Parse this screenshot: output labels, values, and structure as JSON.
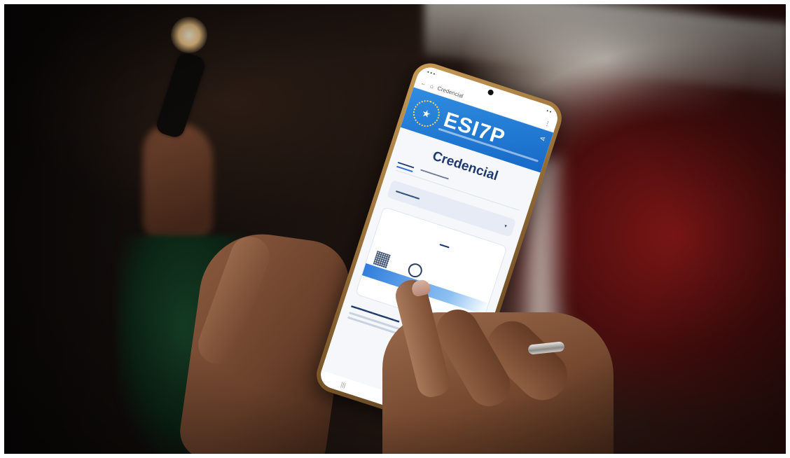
{
  "phone_app": {
    "url_bar": {
      "page_title": "Credencial"
    },
    "banner": {
      "logo": "ESI7P"
    },
    "page_title": "Credencial"
  }
}
